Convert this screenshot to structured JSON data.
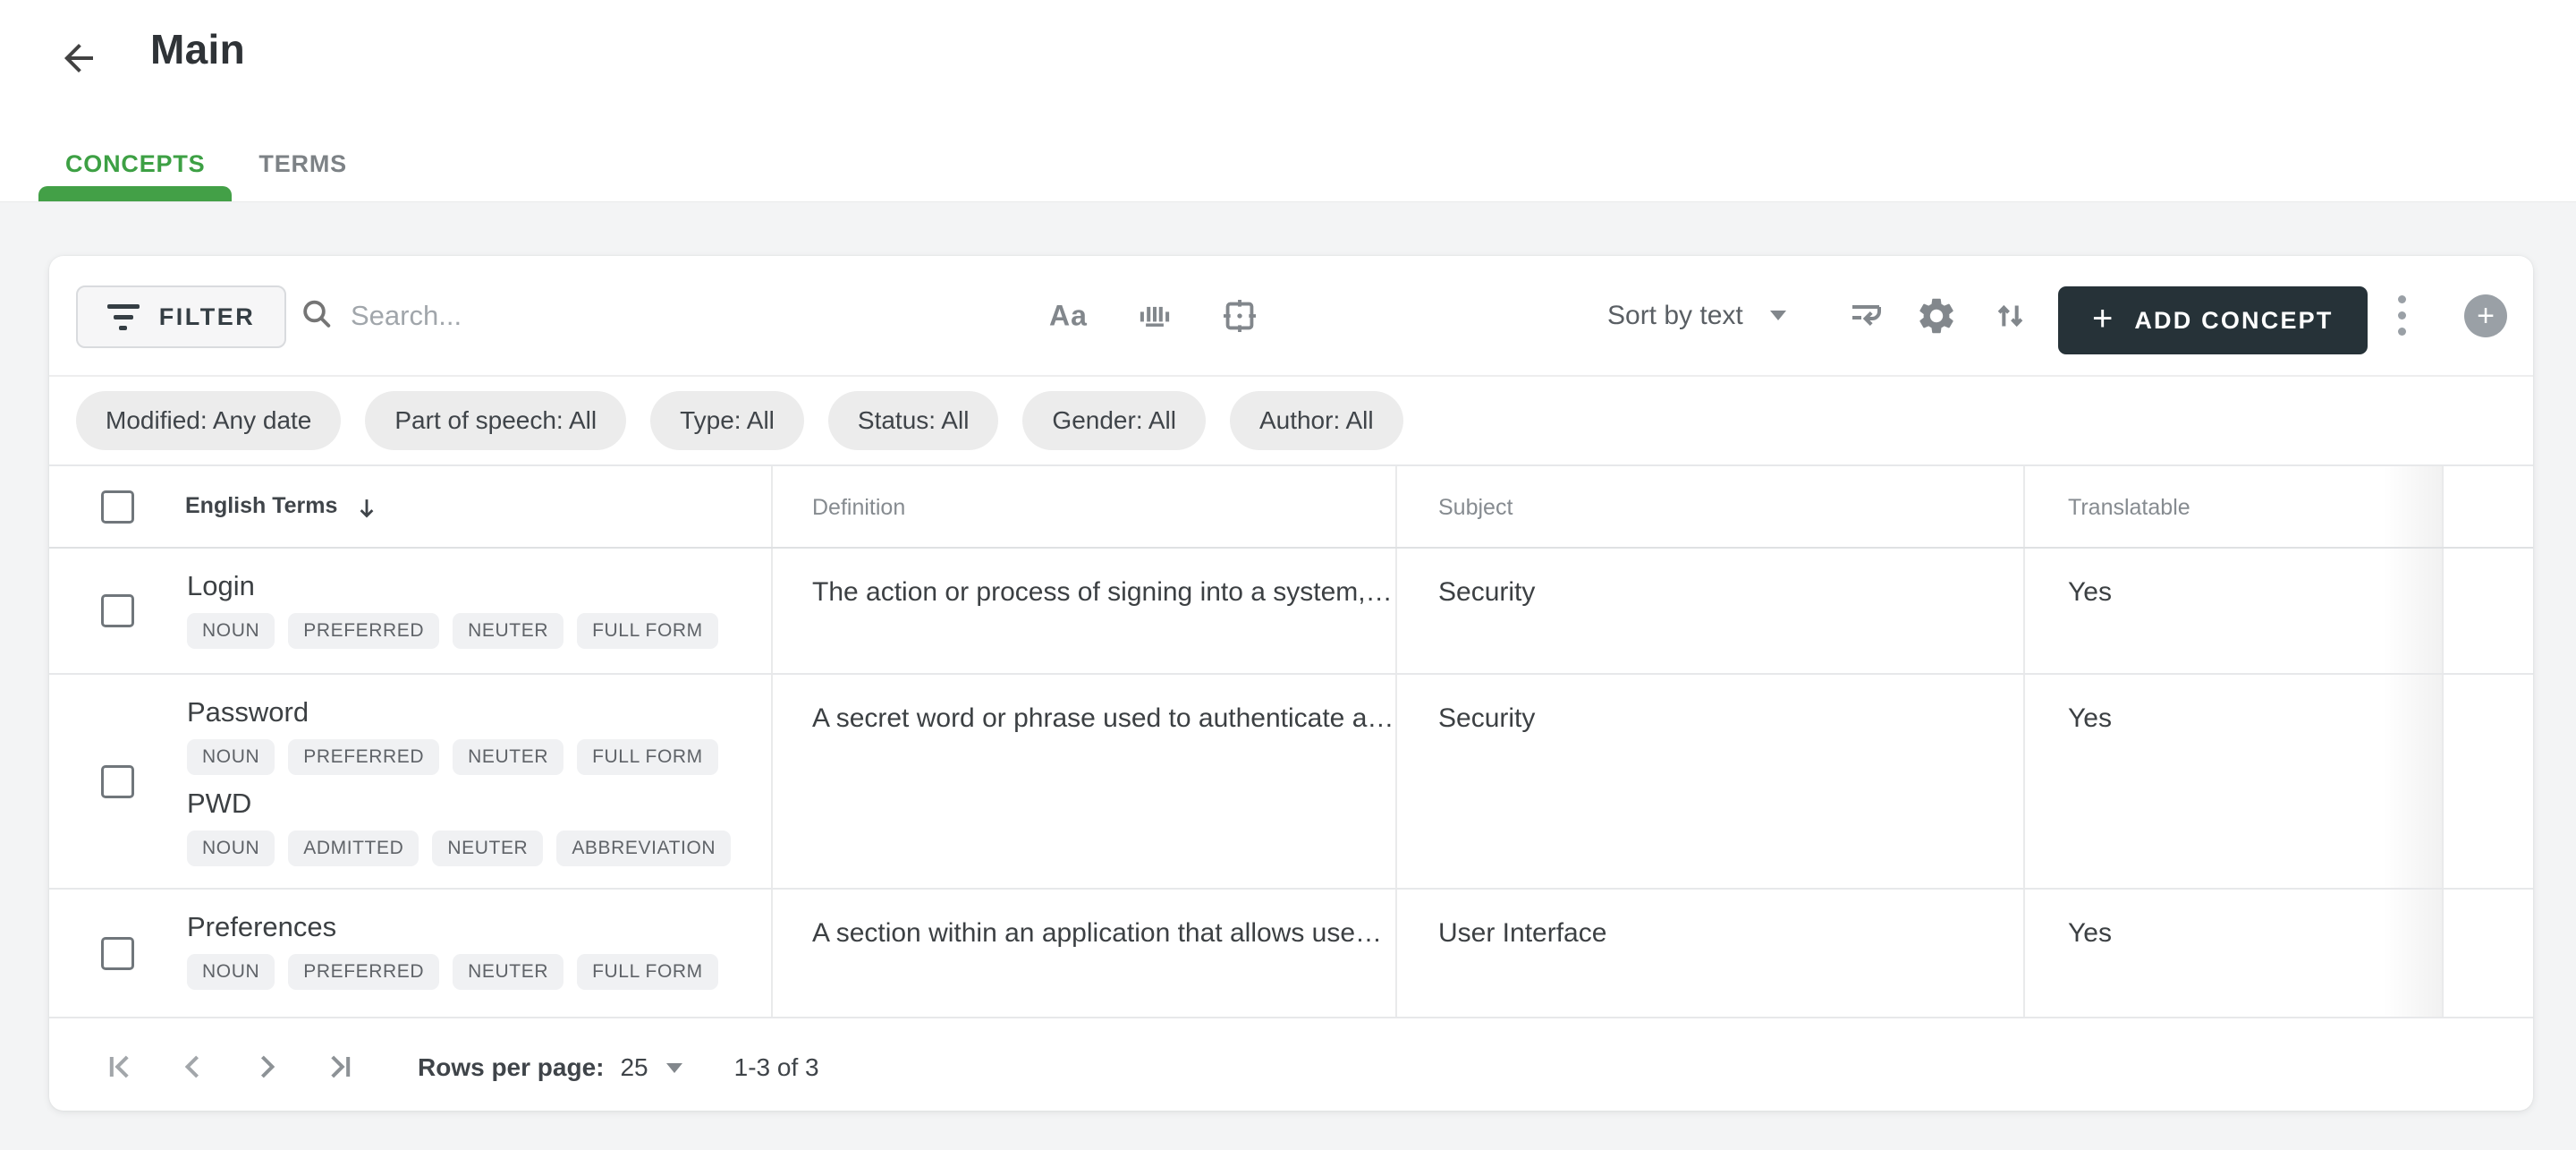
{
  "header": {
    "title": "Main",
    "tabs": [
      {
        "label": "CONCEPTS"
      },
      {
        "label": "TERMS"
      }
    ]
  },
  "toolbar": {
    "filter_label": "FILTER",
    "search_placeholder": "Search...",
    "match_case_glyph": "Aa",
    "sort_label": "Sort by text",
    "add_plus_glyph": "+",
    "add_concept_label": "ADD CONCEPT",
    "circle_plus_glyph": "+"
  },
  "filters": {
    "chips": [
      "Modified: Any date",
      "Part of speech: All",
      "Type: All",
      "Status: All",
      "Gender: All",
      "Author: All"
    ]
  },
  "table": {
    "columns": [
      "English Terms",
      "Definition",
      "Subject",
      "Translatable"
    ],
    "rows": [
      {
        "terms": [
          {
            "text": "Login",
            "badges": [
              "NOUN",
              "PREFERRED",
              "NEUTER",
              "FULL FORM"
            ]
          }
        ],
        "definition": "The action or process of signing into a system,…",
        "subject": "Security",
        "translatable": "Yes"
      },
      {
        "terms": [
          {
            "text": "Password",
            "badges": [
              "NOUN",
              "PREFERRED",
              "NEUTER",
              "FULL FORM"
            ]
          },
          {
            "text": "PWD",
            "badges": [
              "NOUN",
              "ADMITTED",
              "NEUTER",
              "ABBREVIATION"
            ]
          }
        ],
        "definition": "A secret word or phrase used to authenticate a…",
        "subject": "Security",
        "translatable": "Yes"
      },
      {
        "terms": [
          {
            "text": "Preferences",
            "badges": [
              "NOUN",
              "PREFERRED",
              "NEUTER",
              "FULL FORM"
            ]
          }
        ],
        "definition": "A section within an application that allows use…",
        "subject": "User Interface",
        "translatable": "Yes"
      }
    ]
  },
  "pagination": {
    "rows_per_page_label": "Rows per page:",
    "rows_per_page_value": "25",
    "range": "1-3 of 3"
  },
  "colors": {
    "accent_green": "#43a047",
    "dark_button": "#263238",
    "page_background": "#f3f4f5"
  }
}
